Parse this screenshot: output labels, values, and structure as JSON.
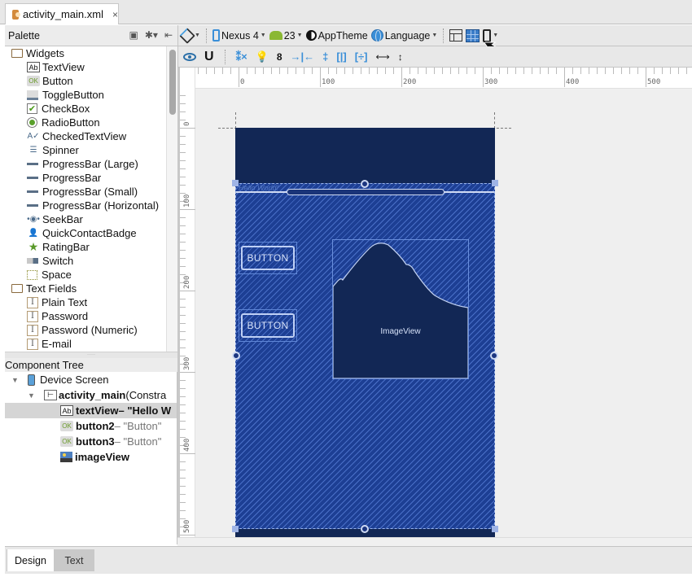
{
  "editor_tab": {
    "filename": "activity_main.xml",
    "close_icon": "×"
  },
  "palette": {
    "title": "Palette",
    "categories": [
      {
        "label": "Widgets",
        "items": [
          {
            "label": "TextView",
            "icon": "textview-icon",
            "glyph": "Ab"
          },
          {
            "label": "Button",
            "icon": "button-icon",
            "glyph": "OK"
          },
          {
            "label": "ToggleButton",
            "icon": "togglebutton-icon",
            "glyph": ""
          },
          {
            "label": "CheckBox",
            "icon": "checkbox-icon",
            "glyph": "✔"
          },
          {
            "label": "RadioButton",
            "icon": "radiobutton-icon",
            "glyph": ""
          },
          {
            "label": "CheckedTextView",
            "icon": "checkedtextview-icon",
            "glyph": "A✓"
          },
          {
            "label": "Spinner",
            "icon": "spinner-icon",
            "glyph": "☰"
          },
          {
            "label": "ProgressBar (Large)",
            "icon": "progressbar-icon",
            "glyph": ""
          },
          {
            "label": "ProgressBar",
            "icon": "progressbar-icon",
            "glyph": ""
          },
          {
            "label": "ProgressBar (Small)",
            "icon": "progressbar-icon",
            "glyph": ""
          },
          {
            "label": "ProgressBar (Horizontal)",
            "icon": "progressbar-icon",
            "glyph": ""
          },
          {
            "label": "SeekBar",
            "icon": "seekbar-icon",
            "glyph": "•◉•"
          },
          {
            "label": "QuickContactBadge",
            "icon": "quickcontactbadge-icon",
            "glyph": "👤"
          },
          {
            "label": "RatingBar",
            "icon": "ratingbar-icon",
            "glyph": "★"
          },
          {
            "label": "Switch",
            "icon": "switch-icon",
            "glyph": ""
          },
          {
            "label": "Space",
            "icon": "space-icon",
            "glyph": ""
          }
        ]
      },
      {
        "label": "Text Fields",
        "items": [
          {
            "label": "Plain Text",
            "icon": "text-field-icon",
            "glyph": "I"
          },
          {
            "label": "Password",
            "icon": "text-field-icon",
            "glyph": "I"
          },
          {
            "label": "Password (Numeric)",
            "icon": "text-field-icon",
            "glyph": "I"
          },
          {
            "label": "E-mail",
            "icon": "text-field-icon",
            "glyph": "I"
          }
        ]
      }
    ]
  },
  "component_tree": {
    "title": "Component Tree",
    "nodes": [
      {
        "name": "Device Screen",
        "detail": ""
      },
      {
        "name": "activity_main",
        "detail": " (Constra"
      },
      {
        "name": "textView",
        "detail": " – \"Hello W"
      },
      {
        "name": "button2",
        "detail": " – \"Button\""
      },
      {
        "name": "button3",
        "detail": " – \"Button\""
      },
      {
        "name": "imageView",
        "detail": ""
      }
    ]
  },
  "toolbar": {
    "device": "Nexus 4",
    "api_level": "23",
    "theme": "AppTheme",
    "language": "Language",
    "default_margin": "8"
  },
  "rulers": {
    "horizontal": [
      "0",
      "100",
      "200",
      "300",
      "400",
      "500"
    ],
    "vertical": [
      "0",
      "100",
      "200",
      "300",
      "400",
      "500"
    ]
  },
  "design": {
    "textview_text": "Hello World!",
    "button1_label": "BUTTON",
    "button2_label": "BUTTON",
    "imageview_label": "ImageView"
  },
  "bottom_tabs": {
    "design": "Design",
    "text": "Text",
    "active": "Design"
  },
  "colors": {
    "blueprint_bg": "#1d3f94",
    "blueprint_dark": "#122755",
    "accent": "#3a8fd8"
  }
}
